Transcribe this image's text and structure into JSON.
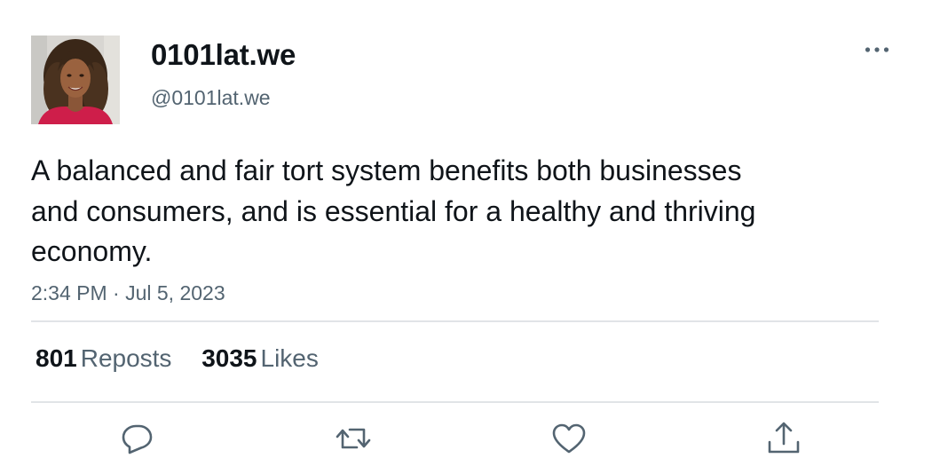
{
  "author": {
    "display_name": "0101lat.we",
    "handle": "@0101lat.we",
    "avatar_icon": "profile-photo-woman"
  },
  "tweet": {
    "text": "A balanced and fair tort system benefits both businesses and consumers, and is essential for a healthy and thriving economy.",
    "timestamp": "2:34 PM · Jul 5, 2023"
  },
  "stats": {
    "reposts_count": "801",
    "reposts_label": "Reposts",
    "likes_count": "3035",
    "likes_label": "Likes"
  },
  "actions": [
    {
      "icon": "reply-icon"
    },
    {
      "icon": "repost-icon"
    },
    {
      "icon": "like-icon"
    },
    {
      "icon": "share-icon"
    }
  ],
  "colors": {
    "text_primary": "#0f1419",
    "text_secondary": "#536471",
    "divider": "#e1e4e7",
    "avatar_top": "#ce1e4a"
  }
}
